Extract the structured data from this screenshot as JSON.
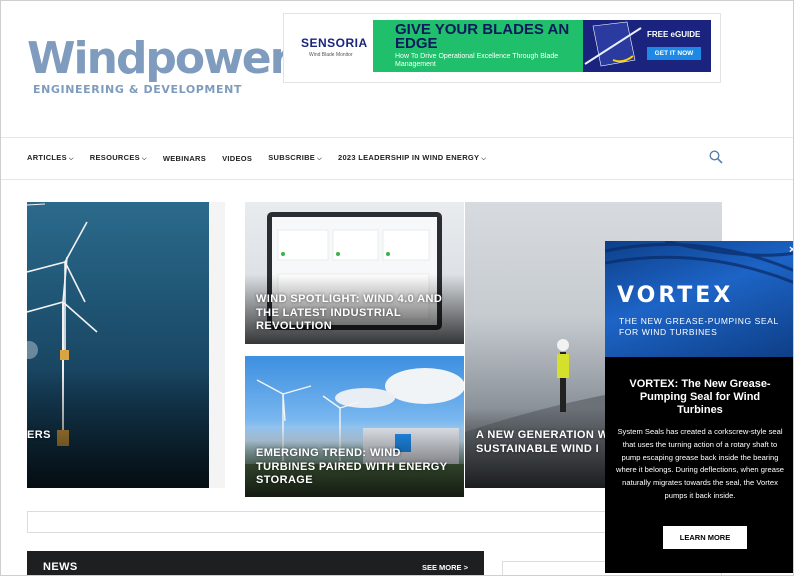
{
  "logo": {
    "main": "Windpower",
    "sub": "ENGINEERING & DEVELOPMENT"
  },
  "ad": {
    "brand": "SENSORIA",
    "brand_tag": "Wind Blade Monitor",
    "headline": "GIVE YOUR BLADES AN EDGE",
    "subline": "How To Drive Operational Excellence Through Blade Management",
    "guide": "FREE eGUIDE",
    "cta": "GET IT NOW",
    "colors": {
      "navy": "#1a237e",
      "green": "#1fbf6b",
      "cta": "#1e88e5"
    }
  },
  "nav": {
    "items": [
      {
        "label": "ARTICLES",
        "dropdown": true
      },
      {
        "label": "RESOURCES",
        "dropdown": true
      },
      {
        "label": "WEBINARS",
        "dropdown": false
      },
      {
        "label": "VIDEOS",
        "dropdown": false
      },
      {
        "label": "SUBSCRIBE",
        "dropdown": true
      },
      {
        "label": "2023 LEADERSHIP IN WIND ENERGY",
        "dropdown": true
      }
    ],
    "search_icon": "search-icon"
  },
  "hero": {
    "left_title": "ERS",
    "mid_top_title": "WIND SPOTLIGHT: WIND 4.0 AND THE LATEST INDUSTRIAL REVOLUTION",
    "mid_bottom_title": "EMERGING TREND: WIND TURBINES PAIRED WITH ENERGY STORAGE",
    "right_title": "A NEW GENERATION WIND CONVERTERS F SUSTAINABLE WIND I"
  },
  "news": {
    "title": "NEWS",
    "more": "SEE MORE >"
  },
  "popup": {
    "brand": "VORTEX",
    "tagline": "THE NEW GREASE-PUMPING SEAL FOR WIND TURBINES",
    "headline": "VORTEX: The New Grease-Pumping Seal for Wind Turbines",
    "body": "System Seals has created a corkscrew-style seal that uses the turning action of a rotary shaft to pump escaping grease back inside the bearing where it belongs. During deflections, when grease naturally migrates towards the seal, the Vortex pumps it back inside.",
    "button": "LEARN MORE",
    "close": "×"
  }
}
